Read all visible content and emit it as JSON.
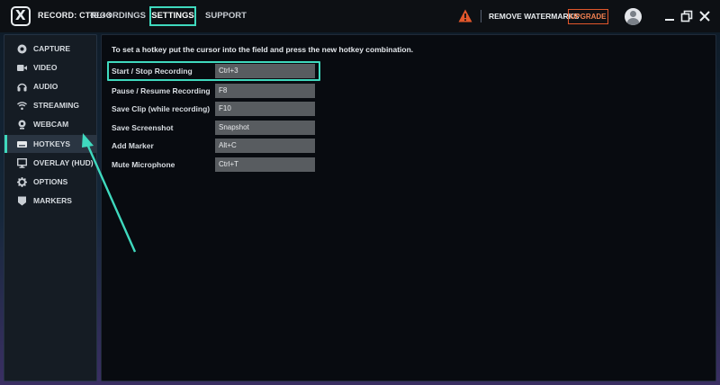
{
  "topbar": {
    "record_label": "RECORD: CTRL+3",
    "tabs": [
      {
        "label": "RECORDINGS"
      },
      {
        "label": "SETTINGS"
      },
      {
        "label": "SUPPORT"
      }
    ],
    "remove_watermarks": "REMOVE WATERMARKS",
    "upgrade": "UPGRADE"
  },
  "sidebar": {
    "items": [
      {
        "label": "CAPTURE",
        "icon": "record-icon"
      },
      {
        "label": "VIDEO",
        "icon": "video-camera-icon"
      },
      {
        "label": "AUDIO",
        "icon": "headphones-icon"
      },
      {
        "label": "STREAMING",
        "icon": "wifi-icon"
      },
      {
        "label": "WEBCAM",
        "icon": "webcam-icon"
      },
      {
        "label": "HOTKEYS",
        "icon": "keyboard-icon",
        "active": true
      },
      {
        "label": "OVERLAY (HUD)",
        "icon": "monitor-icon"
      },
      {
        "label": "OPTIONS",
        "icon": "gear-icon"
      },
      {
        "label": "MARKERS",
        "icon": "marker-icon"
      }
    ]
  },
  "main": {
    "instructions": "To set a hotkey put the cursor into the field and press the new hotkey combination.",
    "hotkeys": [
      {
        "label": "Start / Stop Recording",
        "value": "Ctrl+3"
      },
      {
        "label": "Pause / Resume Recording",
        "value": "F8"
      },
      {
        "label": "Save Clip (while recording)",
        "value": "F10"
      },
      {
        "label": "Save Screenshot",
        "value": "Snapshot"
      },
      {
        "label": "Add Marker",
        "value": "Alt+C"
      },
      {
        "label": "Mute Microphone",
        "value": "Ctrl+T"
      }
    ]
  },
  "colors": {
    "accent": "#3fd9be",
    "warning": "#e2572b",
    "background": "#080b10"
  }
}
